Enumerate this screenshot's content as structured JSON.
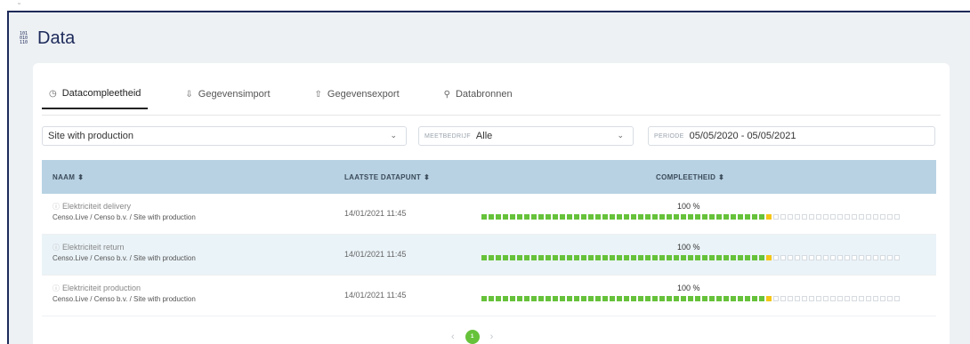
{
  "app": {
    "title": "Data",
    "title_icon": "binary-data-icon",
    "title_icon_glyph": [
      "101",
      "010",
      "110"
    ],
    "top_mark": "˜"
  },
  "tabs": [
    {
      "label": "Datacompleetheid",
      "icon": "clock-icon",
      "glyph": "◷",
      "active": true
    },
    {
      "label": "Gegevensimport",
      "icon": "cloud-download-icon",
      "glyph": "⇩",
      "active": false
    },
    {
      "label": "Gegevensexport",
      "icon": "cloud-upload-icon",
      "glyph": "⇧",
      "active": false
    },
    {
      "label": "Databronnen",
      "icon": "data-sources-icon",
      "glyph": "⚲",
      "active": false
    }
  ],
  "filters": {
    "site": {
      "value": "Site with production",
      "chevron": "⌄"
    },
    "meetbedrijf": {
      "label": "MEETBEDRIJF",
      "value": "Alle",
      "chevron": "⌄"
    },
    "periode": {
      "label": "PERIODE",
      "value": "05/05/2020 - 05/05/2021"
    }
  },
  "table": {
    "headers": {
      "naam": "NAAM",
      "laatste": "LAATSTE DATAPUNT",
      "compleetheid": "COMPLEETHEID",
      "sort_glyph": "⬍"
    },
    "rows": [
      {
        "name": "Elektriciteit delivery",
        "path": "Censo.Live / Censo b.v. / Site with production",
        "timestamp": "14/01/2021 11:45",
        "percent": "100 %",
        "filled_fraction": 0.69
      },
      {
        "name": "Elektriciteit return",
        "path": "Censo.Live / Censo b.v. / Site with production",
        "timestamp": "14/01/2021 11:45",
        "percent": "100 %",
        "filled_fraction": 0.69
      },
      {
        "name": "Elektriciteit production",
        "path": "Censo.Live / Censo b.v. / Site with production",
        "timestamp": "14/01/2021 11:45",
        "percent": "100 %",
        "filled_fraction": 0.69
      }
    ]
  },
  "pagination": {
    "current": "1",
    "prev": "‹",
    "next": "›"
  },
  "colors": {
    "accent": "#66c23a",
    "marker": "#f5c518",
    "header_bg": "#b8d2e3",
    "brand": "#1d2a5a"
  }
}
